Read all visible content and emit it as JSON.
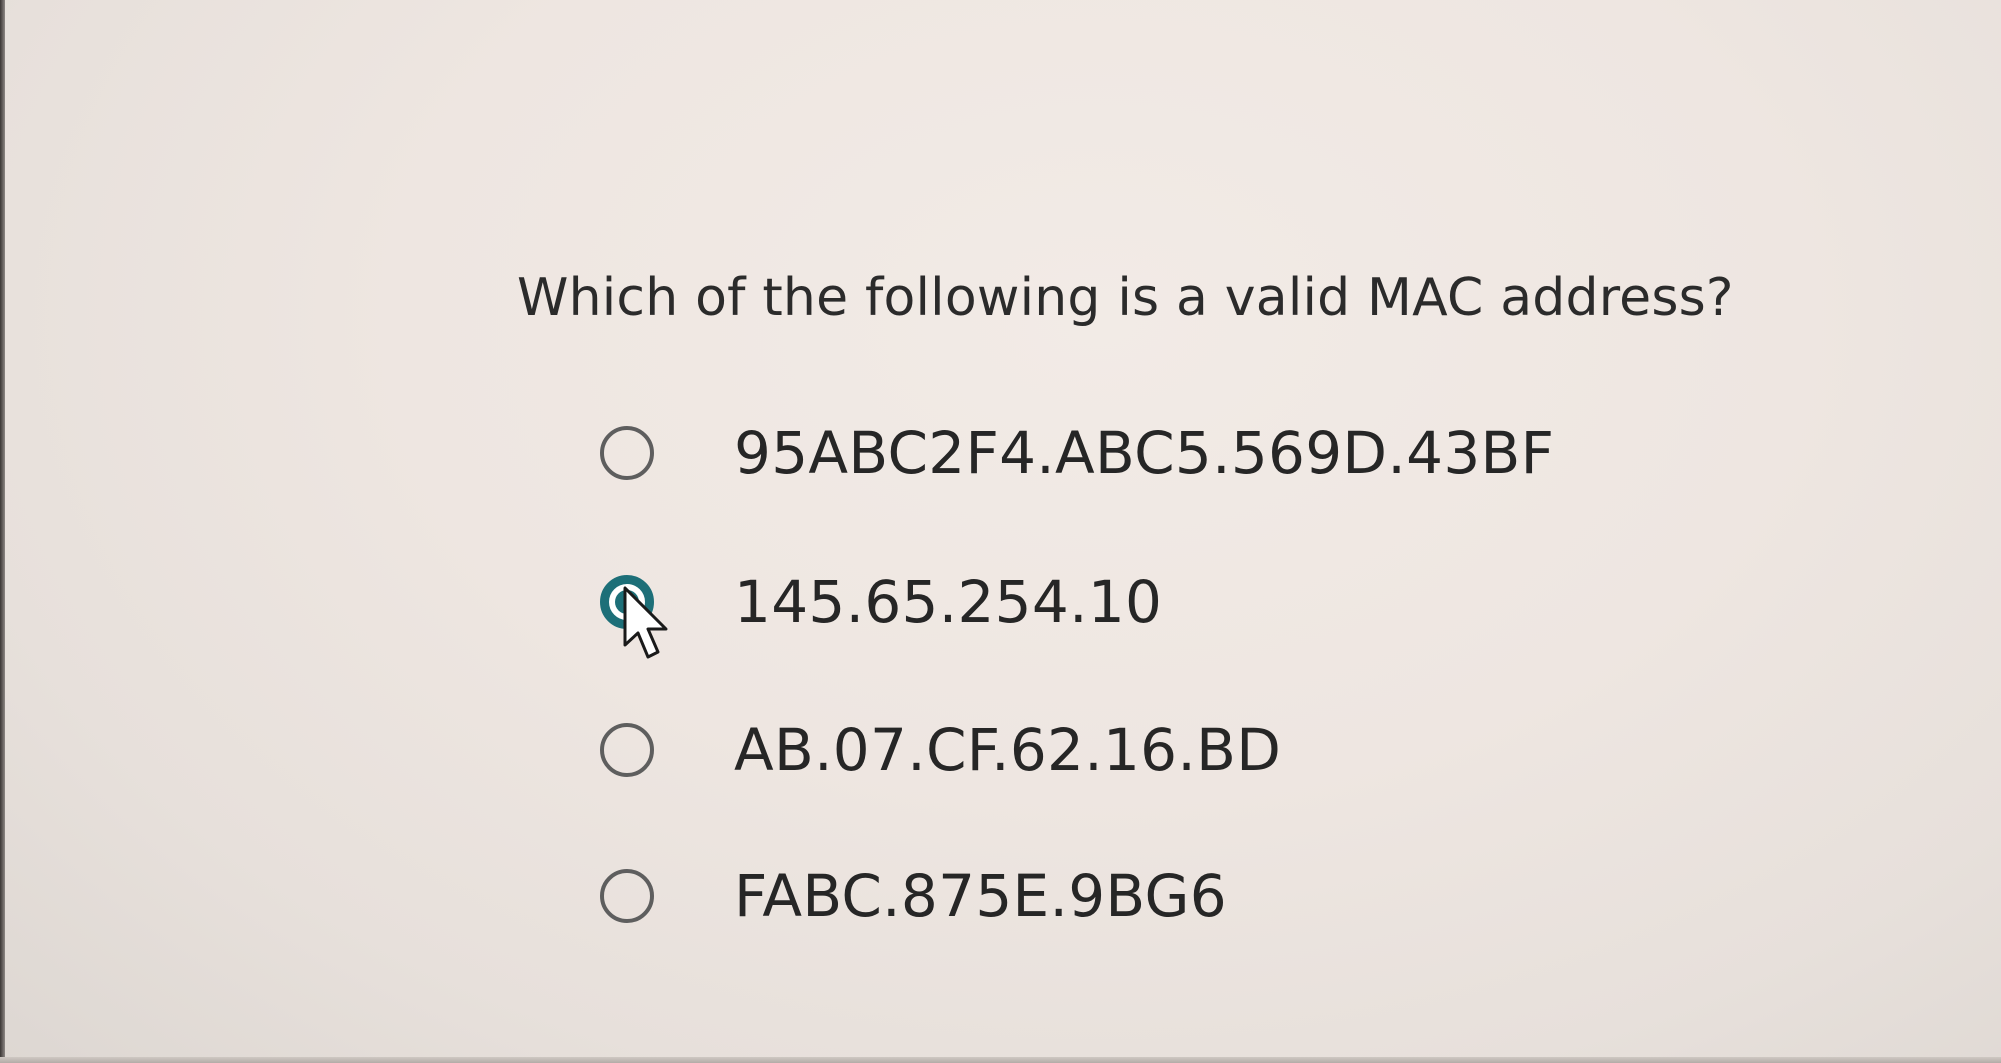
{
  "question": {
    "text": "Which of the following is a valid MAC address?"
  },
  "options": [
    {
      "label": "95ABC2F4.ABC5.569D.43BF",
      "selected": false
    },
    {
      "label": "145.65.254.10",
      "selected": true
    },
    {
      "label": "AB.07.CF.62.16.BD",
      "selected": false
    },
    {
      "label": "FABC.875E.9BG6",
      "selected": false
    }
  ],
  "colors": {
    "accent": "#1d6f78",
    "radio_border": "#5e5e5e",
    "text": "#2a2a2a"
  },
  "icons": {
    "cursor": "mouse-pointer-icon"
  }
}
